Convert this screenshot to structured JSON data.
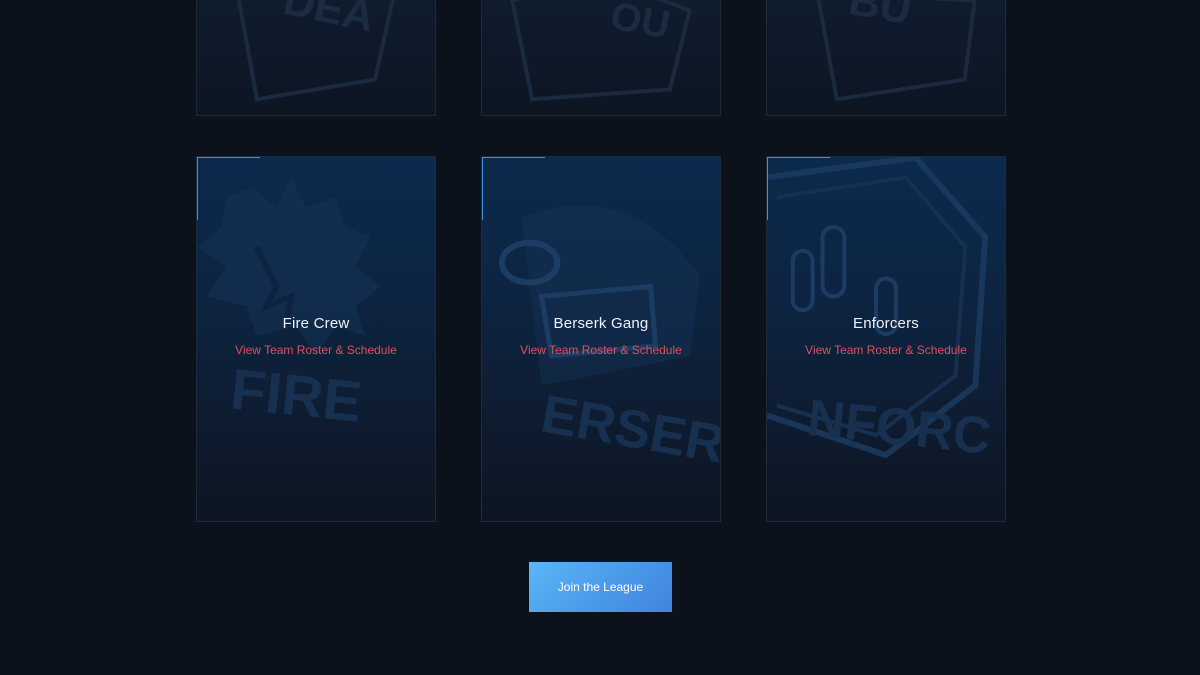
{
  "top_row_cards": [
    {
      "crest_text": "DEA"
    },
    {
      "crest_text": "OU"
    },
    {
      "crest_text": "BU"
    }
  ],
  "teams": [
    {
      "name": "Fire Crew",
      "link": "View Team Roster & Schedule",
      "crest_text": "FIRE"
    },
    {
      "name": "Berserk Gang",
      "link": "View Team Roster & Schedule",
      "crest_text": "ERSER"
    },
    {
      "name": "Enforcers",
      "link": "View Team Roster & Schedule",
      "crest_text": "NFORC"
    }
  ],
  "cta": {
    "label": "Join the League"
  },
  "colors": {
    "background": "#0c121c",
    "card_gradient_top": "#0c2a4d",
    "accent_blue": "#3d8ee0",
    "link_red": "#d9525f",
    "button_start": "#5ab6f5",
    "button_end": "#3f85de"
  }
}
